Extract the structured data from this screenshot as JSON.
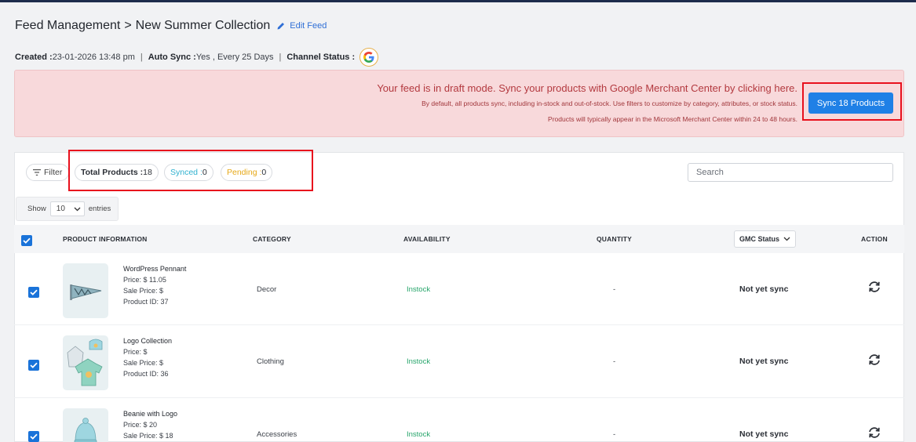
{
  "header": {
    "breadcrumb_root": "Feed Management",
    "breadcrumb_sep": ">",
    "breadcrumb_current": "New Summer Collection",
    "edit_label": "Edit Feed"
  },
  "meta": {
    "created_label": "Created :",
    "created_value": " 23-01-2026 13:48 pm",
    "autosync_label": "Auto Sync :",
    "autosync_value": " Yes , Every 25 Days",
    "channel_label": "Channel Status :"
  },
  "banner": {
    "main": "Your feed is in draft mode. Sync your products with Google Merchant Center by clicking here.",
    "sub1": "By default, all products sync, including in-stock and out-of-stock. Use filters to customize by category, attributes, or stock status.",
    "sub2": "Products will typically appear in the Microsoft Merchant Center within 24 to 48 hours.",
    "button": "Sync 18 Products",
    "colors": {
      "bg": "#f8d9db",
      "text": "#b3393f",
      "button": "#1f80e6"
    }
  },
  "toolbar": {
    "filter_label": "Filter",
    "total_label": "Total Products :",
    "total_value": " 18",
    "synced_label": "Synced :",
    "synced_value": " 0",
    "pending_label": "Pending :",
    "pending_value": " 0",
    "search_placeholder": "Search"
  },
  "pagination": {
    "show_label": "Show",
    "entries_value": "10",
    "entries_label": "entries"
  },
  "table": {
    "columns": {
      "product": "PRODUCT INFORMATION",
      "category": "CATEGORY",
      "availability": "AVAILABILITY",
      "quantity": "QUANTITY",
      "gmc_status": "GMC Status",
      "action": "ACTION"
    },
    "rows": [
      {
        "name": "WordPress Pennant",
        "price": "Price: $ 11.05",
        "sale_price": "Sale Price: $",
        "product_id": "Product ID: 37",
        "category": "Decor",
        "availability": "Instock",
        "quantity": "-",
        "gmc_status": "Not yet sync",
        "image_icon": "pennant-icon"
      },
      {
        "name": "Logo Collection",
        "price": "Price: $",
        "sale_price": "Sale Price: $",
        "product_id": "Product ID: 36",
        "category": "Clothing",
        "availability": "Instock",
        "quantity": "-",
        "gmc_status": "Not yet sync",
        "image_icon": "clothing-set-icon"
      },
      {
        "name": "Beanie with Logo",
        "price": "Price: $ 20",
        "sale_price": "Sale Price: $ 18",
        "product_id": "",
        "category": "Accessories",
        "availability": "Instock",
        "quantity": "-",
        "gmc_status": "Not yet sync",
        "image_icon": "beanie-icon"
      }
    ]
  }
}
